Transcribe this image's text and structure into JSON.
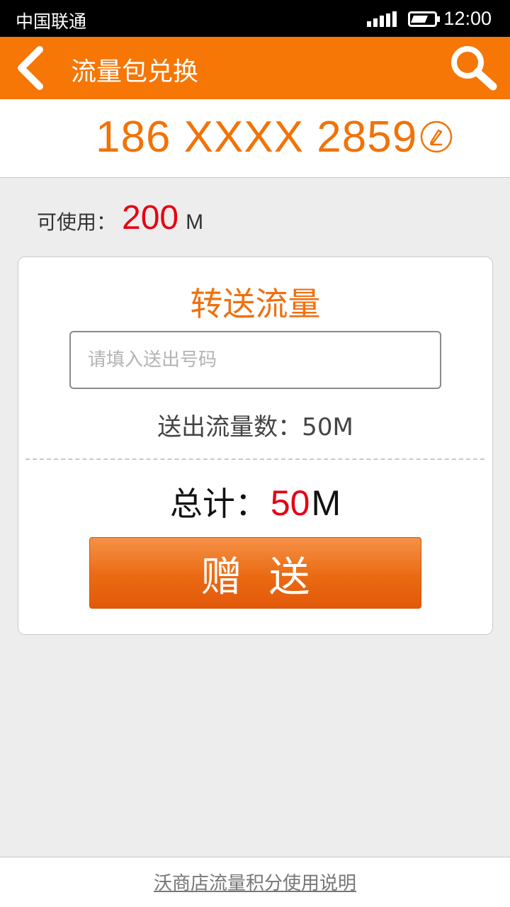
{
  "status_bar": {
    "carrier": "中国联通",
    "time": "12:00"
  },
  "app_bar": {
    "title": "流量包兑换",
    "back_icon": "back-chevron-icon",
    "search_icon": "search-icon"
  },
  "account": {
    "phone": "186 XXXX 2859",
    "edit_icon": "edit-pencil-icon"
  },
  "available": {
    "label": "可使用：",
    "value": "200",
    "unit": "M"
  },
  "transfer": {
    "title": "转送流量",
    "input_placeholder": "请填入送出号码",
    "send_amount": "送出流量数：50M",
    "total_label": "总计：",
    "total_value": "50",
    "total_unit": "M",
    "gift_button": "赠送"
  },
  "footer": {
    "link": "沃商店流量积分使用说明"
  },
  "colors": {
    "accent": "#f67606",
    "highlight": "#e60012"
  }
}
